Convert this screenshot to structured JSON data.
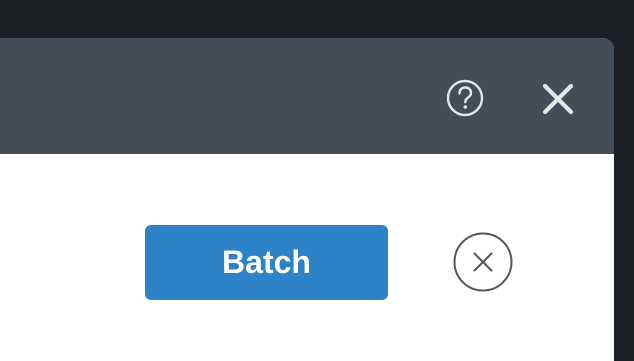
{
  "dialog": {
    "header": {
      "help_icon": "question-circle-icon",
      "close_icon": "close-x-icon"
    },
    "body": {
      "batch_button_label": "Batch",
      "remove_icon": "circle-x-icon"
    }
  },
  "colors": {
    "backdrop": "#1b1e22",
    "header": "#434c57",
    "body": "#ffffff",
    "primary_button": "#2d82c8",
    "icon_light": "#e4e7ea",
    "icon_dark": "#555555"
  }
}
